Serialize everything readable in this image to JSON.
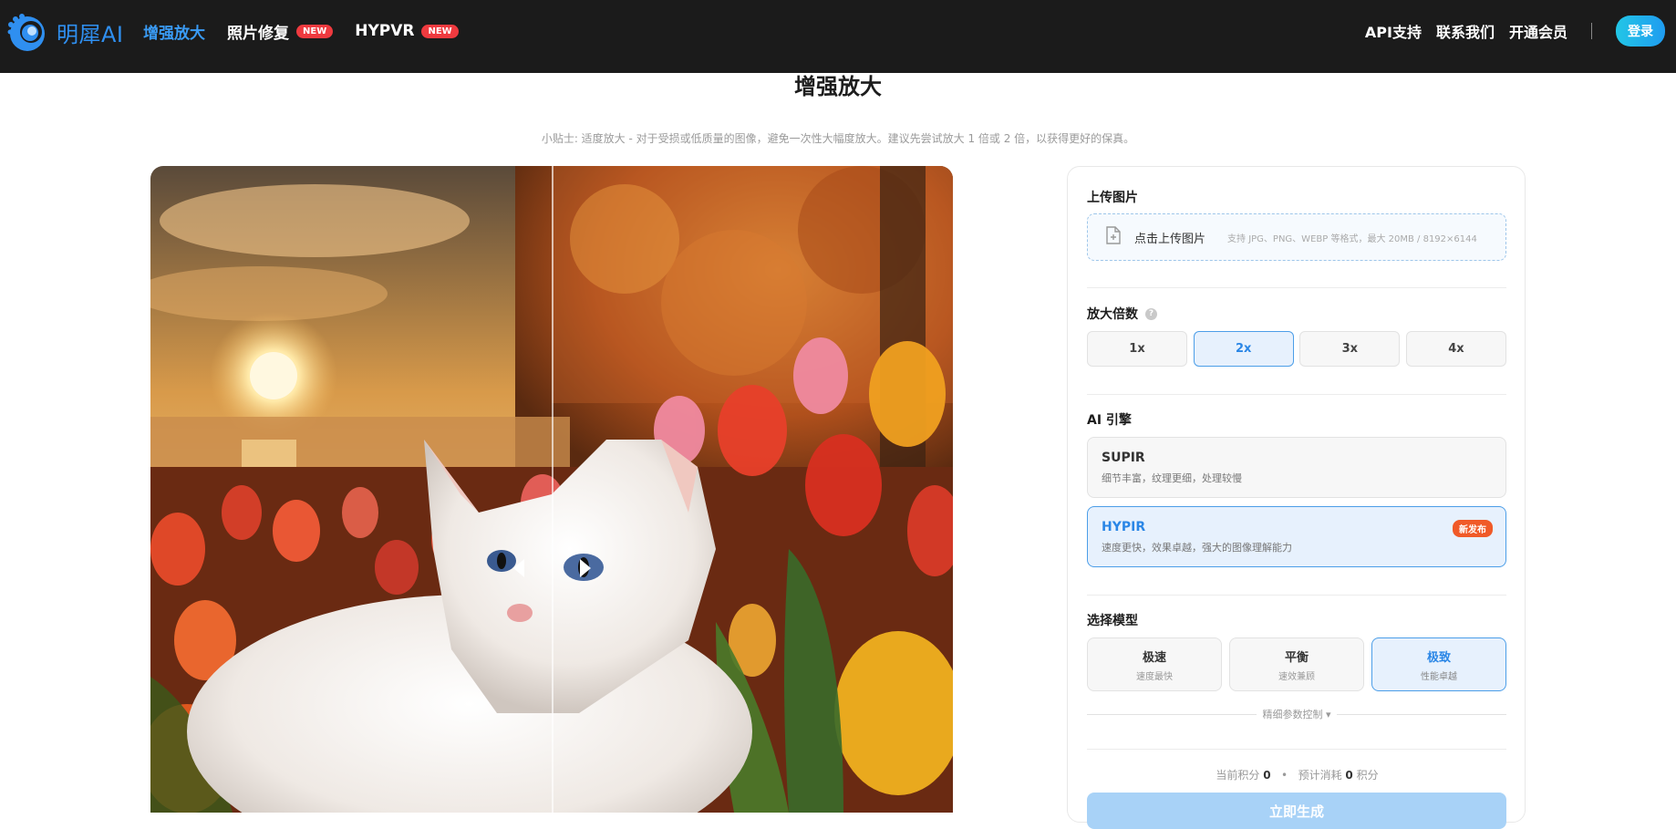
{
  "header": {
    "logo_text": "明犀AI",
    "nav": [
      {
        "label": "增强放大",
        "badge": "",
        "active": true
      },
      {
        "label": "照片修复",
        "badge": "NEW",
        "active": false
      },
      {
        "label": "HYPVR",
        "badge": "NEW",
        "active": false
      }
    ],
    "right_links": [
      "API支持",
      "联系我们",
      "开通会员"
    ],
    "login_label": "登录"
  },
  "page": {
    "title": "增强放大",
    "tip": "小贴士: 适度放大 - 对于受损或低质量的图像，避免一次性大幅度放大。建议先尝试放大 1 倍或 2 倍，以获得更好的保真。"
  },
  "panel": {
    "upload": {
      "section_label": "上传图片",
      "button_label": "点击上传图片",
      "hint": "支持 JPG、PNG、WEBP 等格式，最大 20MB / 8192×6144"
    },
    "scale": {
      "section_label": "放大倍数",
      "options": [
        "1x",
        "2x",
        "3x",
        "4x"
      ],
      "selected": "2x"
    },
    "engine": {
      "section_label": "AI 引擎",
      "options": [
        {
          "name": "SUPIR",
          "desc": "细节丰富，纹理更细，处理较慢",
          "badge": ""
        },
        {
          "name": "HYPIR",
          "desc": "速度更快，效果卓越，强大的图像理解能力",
          "badge": "新发布"
        }
      ],
      "selected": "HYPIR"
    },
    "model": {
      "section_label": "选择模型",
      "options": [
        {
          "name": "极速",
          "desc": "速度最快"
        },
        {
          "name": "平衡",
          "desc": "速效兼顾"
        },
        {
          "name": "极致",
          "desc": "性能卓越"
        }
      ],
      "selected": "极致"
    },
    "fine_control_label": "精细参数控制",
    "credits": {
      "current_label": "当前积分",
      "current_value": "0",
      "separator": "•",
      "cost_label": "预计消耗",
      "cost_value": "0",
      "cost_unit": "积分"
    },
    "submit_label": "立即生成"
  },
  "colors": {
    "accent": "#2a86e6",
    "header_bg": "#1b1b1b",
    "badge_red": "#ef3a3f",
    "badge_orange": "#f05a28",
    "submit_disabled": "#a8d2f7"
  }
}
